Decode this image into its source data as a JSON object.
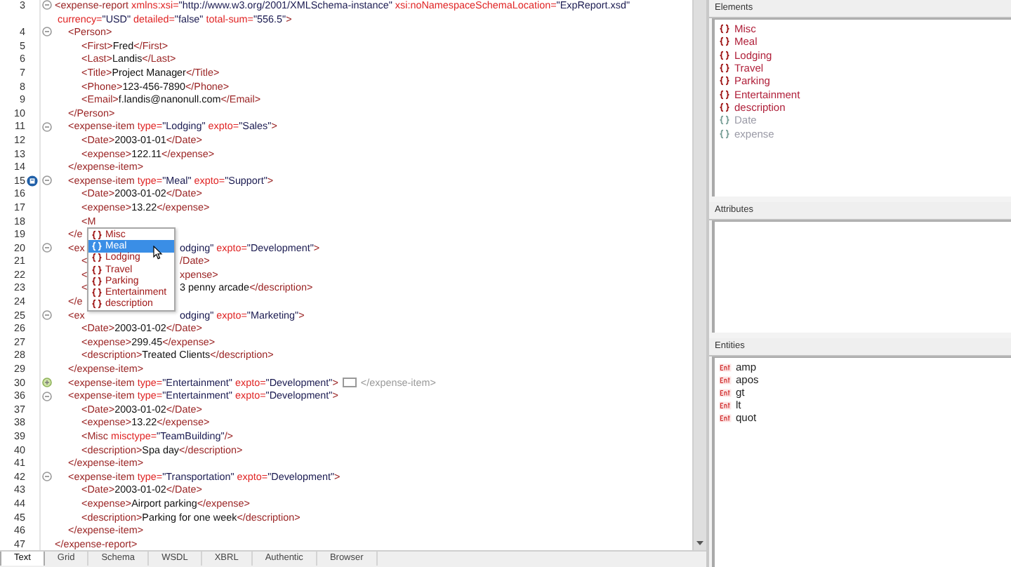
{
  "code": {
    "lines": [
      {
        "number": "3",
        "expanded": true,
        "tokens": [
          {
            "kind": "tag",
            "text": "<expense-report"
          },
          {
            "kind": "attr",
            "text": " xmlns:xsi="
          },
          {
            "kind": "value",
            "text": "\"http://www.w3.org/2001/XMLSchema-instance\""
          },
          {
            "kind": "attr",
            "text": " xsi:noNamespaceSchemaLocation="
          },
          {
            "kind": "value",
            "text": "\"ExpReport.xsd\""
          }
        ],
        "continuation": [
          {
            "kind": "attr",
            "text": "currency="
          },
          {
            "kind": "value",
            "text": "\"USD\""
          },
          {
            "kind": "attr",
            "text": " detailed="
          },
          {
            "kind": "value",
            "text": "\"false\""
          },
          {
            "kind": "attr",
            "text": " total-sum="
          },
          {
            "kind": "value",
            "text": "\"556.5\""
          },
          {
            "kind": "tag",
            "text": ">"
          }
        ],
        "children": [
          {
            "number": "4",
            "expanded": true,
            "tokens": [
              {
                "kind": "tag",
                "text": "<Person>"
              }
            ],
            "children": [
              {
                "number": "5",
                "tokens": [
                  {
                    "kind": "tag",
                    "text": "<First>"
                  },
                  {
                    "kind": "text",
                    "text": "Fred"
                  },
                  {
                    "kind": "tag",
                    "text": "</First>"
                  }
                ]
              },
              {
                "number": "6",
                "tokens": [
                  {
                    "kind": "tag",
                    "text": "<Last>"
                  },
                  {
                    "kind": "text",
                    "text": "Landis"
                  },
                  {
                    "kind": "tag",
                    "text": "</Last>"
                  }
                ]
              },
              {
                "number": "7",
                "tokens": [
                  {
                    "kind": "tag",
                    "text": "<Title>"
                  },
                  {
                    "kind": "text",
                    "text": "Project Manager"
                  },
                  {
                    "kind": "tag",
                    "text": "</Title>"
                  }
                ]
              },
              {
                "number": "8",
                "tokens": [
                  {
                    "kind": "tag",
                    "text": "<Phone>"
                  },
                  {
                    "kind": "text",
                    "text": "123-456-7890"
                  },
                  {
                    "kind": "tag",
                    "text": "</Phone>"
                  }
                ]
              },
              {
                "number": "9",
                "tokens": [
                  {
                    "kind": "tag",
                    "text": "<Email>"
                  },
                  {
                    "kind": "text",
                    "text": "f.landis@nanonull.com"
                  },
                  {
                    "kind": "tag",
                    "text": "</Email>"
                  }
                ]
              }
            ]
          },
          {
            "number": "10",
            "tokens": [
              {
                "kind": "tag",
                "text": "</Person>"
              }
            ]
          },
          {
            "number": "11",
            "expanded": true,
            "tokens": [
              {
                "kind": "tag",
                "text": "<expense-item"
              },
              {
                "kind": "attr",
                "text": " type="
              },
              {
                "kind": "value",
                "text": "\"Lodging\""
              },
              {
                "kind": "attr",
                "text": " expto="
              },
              {
                "kind": "value",
                "text": "\"Sales\""
              },
              {
                "kind": "tag",
                "text": ">"
              }
            ],
            "children": [
              {
                "number": "12",
                "tokens": [
                  {
                    "kind": "tag",
                    "text": "<Date>"
                  },
                  {
                    "kind": "text",
                    "text": "2003-01-01"
                  },
                  {
                    "kind": "tag",
                    "text": "</Date>"
                  }
                ]
              },
              {
                "number": "13",
                "tokens": [
                  {
                    "kind": "tag",
                    "text": "<expense>"
                  },
                  {
                    "kind": "text",
                    "text": "122.11"
                  },
                  {
                    "kind": "tag",
                    "text": "</expense>"
                  }
                ]
              }
            ]
          },
          {
            "number": "14",
            "tokens": [
              {
                "kind": "tag",
                "text": "</expense-item>"
              }
            ]
          },
          {
            "number": "15",
            "bookmarked": true,
            "expanded": true,
            "tokens": [
              {
                "kind": "tag",
                "text": "<expense-item"
              },
              {
                "kind": "attr",
                "text": " type="
              },
              {
                "kind": "value",
                "text": "\"Meal\""
              },
              {
                "kind": "attr",
                "text": " expto="
              },
              {
                "kind": "value",
                "text": "\"Support\""
              },
              {
                "kind": "tag",
                "text": ">"
              }
            ],
            "children": [
              {
                "number": "16",
                "tokens": [
                  {
                    "kind": "tag",
                    "text": "<Date>"
                  },
                  {
                    "kind": "text",
                    "text": "2003-01-02"
                  },
                  {
                    "kind": "tag",
                    "text": "</Date>"
                  }
                ]
              },
              {
                "number": "17",
                "tokens": [
                  {
                    "kind": "tag",
                    "text": "<expense>"
                  },
                  {
                    "kind": "text",
                    "text": "13.22"
                  },
                  {
                    "kind": "tag",
                    "text": "</expense>"
                  }
                ]
              },
              {
                "number": "18",
                "tokens": [
                  {
                    "kind": "tag",
                    "text": "<M"
                  }
                ]
              }
            ]
          },
          {
            "number": "19",
            "tokens": [
              {
                "kind": "tag",
                "text": "</e"
              }
            ],
            "covered": true
          },
          {
            "number": "20",
            "expanded": true,
            "tokens": [
              {
                "kind": "tag",
                "text": "<ex"
              }
            ],
            "tail": [
              {
                "kind": "value",
                "text": "odging\""
              },
              {
                "kind": "attr",
                "text": " expto="
              },
              {
                "kind": "value",
                "text": "\"Development\""
              },
              {
                "kind": "tag",
                "text": ">"
              }
            ],
            "children": [
              {
                "number": "21",
                "tokens": [
                  {
                    "kind": "tag",
                    "text": "<"
                  }
                ],
                "tail": [
                  {
                    "kind": "tag",
                    "text": "/Date>"
                  }
                ]
              },
              {
                "number": "22",
                "tokens": [
                  {
                    "kind": "tag",
                    "text": "<"
                  }
                ],
                "tail": [
                  {
                    "kind": "tag",
                    "text": "xpense>"
                  }
                ]
              },
              {
                "number": "23",
                "tokens": [
                  {
                    "kind": "tag",
                    "text": "<"
                  }
                ],
                "tail": [
                  {
                    "kind": "text",
                    "text": "3 penny arcade"
                  },
                  {
                    "kind": "tag",
                    "text": "</description>"
                  }
                ]
              }
            ]
          },
          {
            "number": "24",
            "tokens": [
              {
                "kind": "tag",
                "text": "</e"
              }
            ],
            "covered": true
          },
          {
            "number": "25",
            "expanded": true,
            "tokens": [
              {
                "kind": "tag",
                "text": "<ex"
              }
            ],
            "tail": [
              {
                "kind": "value",
                "text": "odging\""
              },
              {
                "kind": "attr",
                "text": " expto="
              },
              {
                "kind": "value",
                "text": "\"Marketing\""
              },
              {
                "kind": "tag",
                "text": ">"
              }
            ],
            "children": [
              {
                "number": "26",
                "tokens": [
                  {
                    "kind": "tag",
                    "text": "<Date>"
                  },
                  {
                    "kind": "text",
                    "text": "2003-01-02"
                  },
                  {
                    "kind": "tag",
                    "text": "</Date>"
                  }
                ]
              },
              {
                "number": "27",
                "tokens": [
                  {
                    "kind": "tag",
                    "text": "<expense>"
                  },
                  {
                    "kind": "text",
                    "text": "299.45"
                  },
                  {
                    "kind": "tag",
                    "text": "</expense>"
                  }
                ]
              },
              {
                "number": "28",
                "tokens": [
                  {
                    "kind": "tag",
                    "text": "<description>"
                  },
                  {
                    "kind": "text",
                    "text": "Treated Clients"
                  },
                  {
                    "kind": "tag",
                    "text": "</description>"
                  }
                ]
              }
            ]
          },
          {
            "number": "29",
            "tokens": [
              {
                "kind": "tag",
                "text": "</expense-item>"
              }
            ]
          },
          {
            "number": "30",
            "expanded": false,
            "tokens": [
              {
                "kind": "tag",
                "text": "<expense-item"
              },
              {
                "kind": "attr",
                "text": " type="
              },
              {
                "kind": "value",
                "text": "\"Entertainment\""
              },
              {
                "kind": "attr",
                "text": " expto="
              },
              {
                "kind": "value",
                "text": "\"Development\""
              },
              {
                "kind": "tag",
                "text": ">"
              },
              {
                "kind": "collapsed"
              },
              {
                "kind": "faded",
                "text": "</expense-item>"
              }
            ]
          },
          {
            "number": "36",
            "expanded": true,
            "tokens": [
              {
                "kind": "tag",
                "text": "<expense-item"
              },
              {
                "kind": "attr",
                "text": " type="
              },
              {
                "kind": "value",
                "text": "\"Entertainment\""
              },
              {
                "kind": "attr",
                "text": " expto="
              },
              {
                "kind": "value",
                "text": "\"Development\""
              },
              {
                "kind": "tag",
                "text": ">"
              }
            ],
            "children": [
              {
                "number": "37",
                "tokens": [
                  {
                    "kind": "tag",
                    "text": "<Date>"
                  },
                  {
                    "kind": "text",
                    "text": "2003-01-02"
                  },
                  {
                    "kind": "tag",
                    "text": "</Date>"
                  }
                ]
              },
              {
                "number": "38",
                "tokens": [
                  {
                    "kind": "tag",
                    "text": "<expense>"
                  },
                  {
                    "kind": "text",
                    "text": "13.22"
                  },
                  {
                    "kind": "tag",
                    "text": "</expense>"
                  }
                ]
              },
              {
                "number": "39",
                "tokens": [
                  {
                    "kind": "tag",
                    "text": "<Misc"
                  },
                  {
                    "kind": "attr",
                    "text": " misctype="
                  },
                  {
                    "kind": "value",
                    "text": "\"TeamBuilding\""
                  },
                  {
                    "kind": "tag",
                    "text": "/>"
                  }
                ]
              },
              {
                "number": "40",
                "tokens": [
                  {
                    "kind": "tag",
                    "text": "<description>"
                  },
                  {
                    "kind": "text",
                    "text": "Spa day"
                  },
                  {
                    "kind": "tag",
                    "text": "</description>"
                  }
                ]
              }
            ]
          },
          {
            "number": "41",
            "tokens": [
              {
                "kind": "tag",
                "text": "</expense-item>"
              }
            ]
          },
          {
            "number": "42",
            "expanded": true,
            "tokens": [
              {
                "kind": "tag",
                "text": "<expense-item"
              },
              {
                "kind": "attr",
                "text": " type="
              },
              {
                "kind": "value",
                "text": "\"Transportation\""
              },
              {
                "kind": "attr",
                "text": " expto="
              },
              {
                "kind": "value",
                "text": "\"Development\""
              },
              {
                "kind": "tag",
                "text": ">"
              }
            ],
            "children": [
              {
                "number": "43",
                "tokens": [
                  {
                    "kind": "tag",
                    "text": "<Date>"
                  },
                  {
                    "kind": "text",
                    "text": "2003-01-02"
                  },
                  {
                    "kind": "tag",
                    "text": "</Date>"
                  }
                ]
              },
              {
                "number": "44",
                "tokens": [
                  {
                    "kind": "tag",
                    "text": "<expense>"
                  },
                  {
                    "kind": "text",
                    "text": "Airport parking"
                  },
                  {
                    "kind": "tag",
                    "text": "</expense>"
                  }
                ]
              },
              {
                "number": "45",
                "tokens": [
                  {
                    "kind": "tag",
                    "text": "<description>"
                  },
                  {
                    "kind": "text",
                    "text": "Parking for one week"
                  },
                  {
                    "kind": "tag",
                    "text": "</description>"
                  }
                ]
              }
            ]
          },
          {
            "number": "46",
            "tokens": [
              {
                "kind": "tag",
                "text": "</expense-item>"
              }
            ]
          }
        ]
      },
      {
        "number": "47",
        "tokens": [
          {
            "kind": "tag",
            "text": "</expense-report>"
          }
        ]
      }
    ]
  },
  "completion": {
    "items": [
      {
        "label": "Misc",
        "selected": false
      },
      {
        "label": "Meal",
        "selected": true
      },
      {
        "label": "Lodging",
        "selected": false
      },
      {
        "label": "Travel",
        "selected": false
      },
      {
        "label": "Parking",
        "selected": false
      },
      {
        "label": "Entertainment",
        "selected": false
      },
      {
        "label": "description",
        "selected": false
      }
    ]
  },
  "view_tabs": [
    {
      "label": "Text",
      "selected": true
    },
    {
      "label": "Grid",
      "selected": false
    },
    {
      "label": "Schema",
      "selected": false
    },
    {
      "label": "WSDL",
      "selected": false
    },
    {
      "label": "XBRL",
      "selected": false
    },
    {
      "label": "Authentic",
      "selected": false
    },
    {
      "label": "Browser",
      "selected": false
    }
  ],
  "elements": {
    "title": "Elements",
    "items": [
      {
        "label": "Misc",
        "enabled": true
      },
      {
        "label": "Meal",
        "enabled": true
      },
      {
        "label": "Lodging",
        "enabled": true
      },
      {
        "label": "Travel",
        "enabled": true
      },
      {
        "label": "Parking",
        "enabled": true
      },
      {
        "label": "Entertainment",
        "enabled": true
      },
      {
        "label": "description",
        "enabled": true
      },
      {
        "label": "Date",
        "enabled": false
      },
      {
        "label": "expense",
        "enabled": false
      }
    ]
  },
  "attributes": {
    "title": "Attributes"
  },
  "entities": {
    "title": "Entities",
    "items": [
      {
        "label": "amp"
      },
      {
        "label": "apos"
      },
      {
        "label": "gt"
      },
      {
        "label": "lt"
      },
      {
        "label": "quot"
      }
    ]
  }
}
